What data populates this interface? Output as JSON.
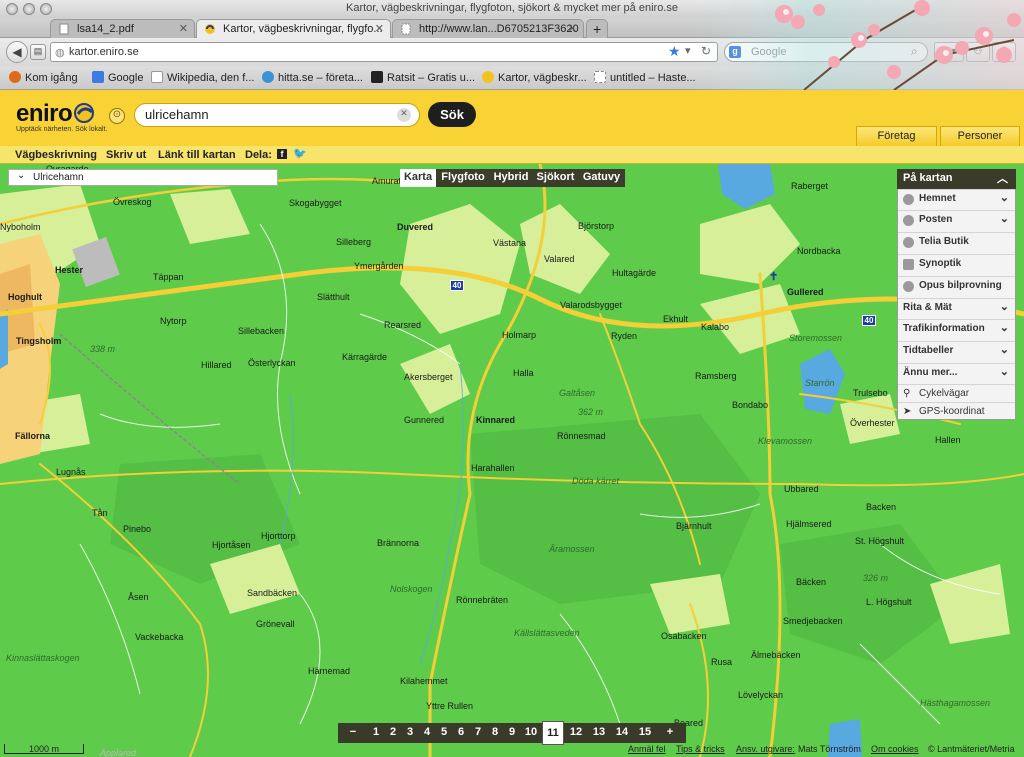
{
  "window": {
    "title": "Kartor, vägbeskrivningar, flygfoton, sjökort & mycket mer på eniro.se"
  },
  "tabs": [
    {
      "label": "lsa14_2.pdf",
      "active": false
    },
    {
      "label": "Kartor, vägbeskrivningar, flygfo...",
      "active": true
    },
    {
      "label": "http://www.lan...D6705213F3620",
      "active": false
    }
  ],
  "new_tab_label": "+",
  "urlbar": {
    "url": "kartor.eniro.se"
  },
  "searchbar": {
    "placeholder": "Google"
  },
  "bookmarks": [
    "Kom igång",
    "Google",
    "Wikipedia, den f...",
    "hitta.se – företa...",
    "Ratsit – Gratis u...",
    "Kartor, vägbeskr...",
    "untitled – Haste..."
  ],
  "eniro": {
    "logo": "eniro",
    "tagline": "Upptäck närheten. Sök lokalt.",
    "search_value": "ulricehamn",
    "search_button": "Sök",
    "header_tabs": [
      "Företag",
      "Personer"
    ],
    "sublinks": [
      "Vägbeskrivning",
      "Skriv ut",
      "Länk till kartan",
      "Dela:"
    ]
  },
  "location_box": "Ulricehamn",
  "map_types": [
    "Karta",
    "Flygfoto",
    "Hybrid",
    "Sjökort",
    "Gatuvy"
  ],
  "active_map_type": "Karta",
  "panel": {
    "title": "På kartan",
    "items": [
      {
        "label": "Hemnet",
        "type": "layer"
      },
      {
        "label": "Posten",
        "type": "layer"
      },
      {
        "label": "Telia Butik",
        "type": "layer"
      },
      {
        "label": "Synoptik",
        "type": "layer"
      },
      {
        "label": "Opus bilprovning",
        "type": "layer"
      },
      {
        "label": "Rita & Mät",
        "type": "section"
      },
      {
        "label": "Trafikinformation",
        "type": "section"
      },
      {
        "label": "Tidtabeller",
        "type": "section"
      },
      {
        "label": "Ännu mer...",
        "type": "section"
      },
      {
        "label": "Cykelvägar",
        "type": "link"
      },
      {
        "label": "GPS-koordinat",
        "type": "link"
      }
    ]
  },
  "zoom": {
    "minus": "−",
    "plus": "+",
    "levels": [
      "1",
      "2",
      "3",
      "4",
      "5",
      "6",
      "7",
      "8",
      "9",
      "10",
      "11",
      "12",
      "13",
      "14",
      "15"
    ],
    "current": "11"
  },
  "scale_label": "1000 m",
  "footer": {
    "links": [
      "Anmäl fel",
      "Tips & tricks",
      "Ansv. utgivare:"
    ],
    "publisher": "Mats Törnström",
    "cookies": "Om cookies",
    "copyright": "© Lantmäteriet/Metria"
  },
  "road_number": "40",
  "map_labels": {
    "bold": [
      "Duvered",
      "Hester",
      "Hoghult",
      "Tingsholm",
      "Fällorna",
      "Kinnared",
      "Gullered"
    ],
    "normal": [
      "Ovragarde",
      "Amurat",
      "Övreskog",
      "Skogabygget",
      "Nyboholm",
      "Silleberg",
      "Västana",
      "Björstorp",
      "Nordbacka",
      "Valared",
      "Hultagärde",
      "Ymergården",
      "Täppan",
      "Slätthult",
      "Valarodsbygget",
      "Ekhult",
      "Kalabo",
      "Nytorp",
      "Rearsred",
      "Holmarp",
      "Ryden",
      "Sillebacken",
      "Kärragärde",
      "Österlyckan",
      "Hillared",
      "Halla",
      "Akersberget",
      "Ramsberg",
      "Bondabo",
      "Trulsebo",
      "Gunnered",
      "Rönnesmad",
      "Överhester",
      "Hallen",
      "Harahallen",
      "Lugnås",
      "Ubbared",
      "Tån",
      "Pinebo",
      "Bjärnhult",
      "Hjälmsered",
      "Backen",
      "Hjortåsen",
      "Hjorttorp",
      "Brännorna",
      "St. Högshult",
      "Åsen",
      "Sandbäcken",
      "Bäcken",
      "Grönevall",
      "Rönnebräten",
      "L. Högshult",
      "Vackebacka",
      "Smedjebacken",
      "Osabacken",
      "Härnemad",
      "Älmebäcken",
      "Rusa",
      "Kilahemmet",
      "Lövelyckan",
      "Yttre Rullen",
      "Boared",
      "Raberget"
    ],
    "italic": [
      "Storemossen",
      "Starrön",
      "Klevamossen",
      "Galtåsen",
      "Döda kärret",
      "Äramossen",
      "Källslättasveden",
      "Nolskogen",
      "Hästhagamossen",
      "Kinnaslättaskogen",
      "Applared"
    ],
    "heights": [
      "362 m",
      "326 m",
      "338 m"
    ]
  }
}
